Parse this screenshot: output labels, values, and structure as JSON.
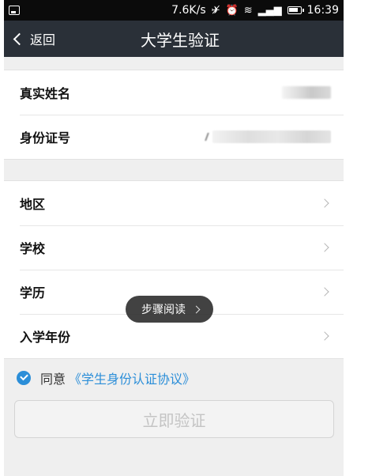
{
  "status_bar": {
    "speed": "7.6K/s",
    "time": "16:39",
    "icons": [
      "screenshot-icon",
      "mute-icon",
      "alarm-icon",
      "wifi-icon",
      "signal-icon",
      "battery-icon"
    ]
  },
  "nav": {
    "back_label": "返回",
    "title": "大学生验证"
  },
  "identity_fields": [
    {
      "label": "真实姓名"
    },
    {
      "label": "身份证号"
    }
  ],
  "school_fields": [
    {
      "label": "地区"
    },
    {
      "label": "学校"
    },
    {
      "label": "学历"
    },
    {
      "label": "入学年份"
    }
  ],
  "toast": {
    "text": "步骤阅读"
  },
  "agreement": {
    "checked": true,
    "prefix": "同意",
    "link_text": "《学生身份认证协议》"
  },
  "submit": {
    "label": "立即验证",
    "enabled": false
  },
  "colors": {
    "nav_bg": "#2a3038",
    "accent": "#2b8ed8",
    "page_bg": "#efefef"
  }
}
